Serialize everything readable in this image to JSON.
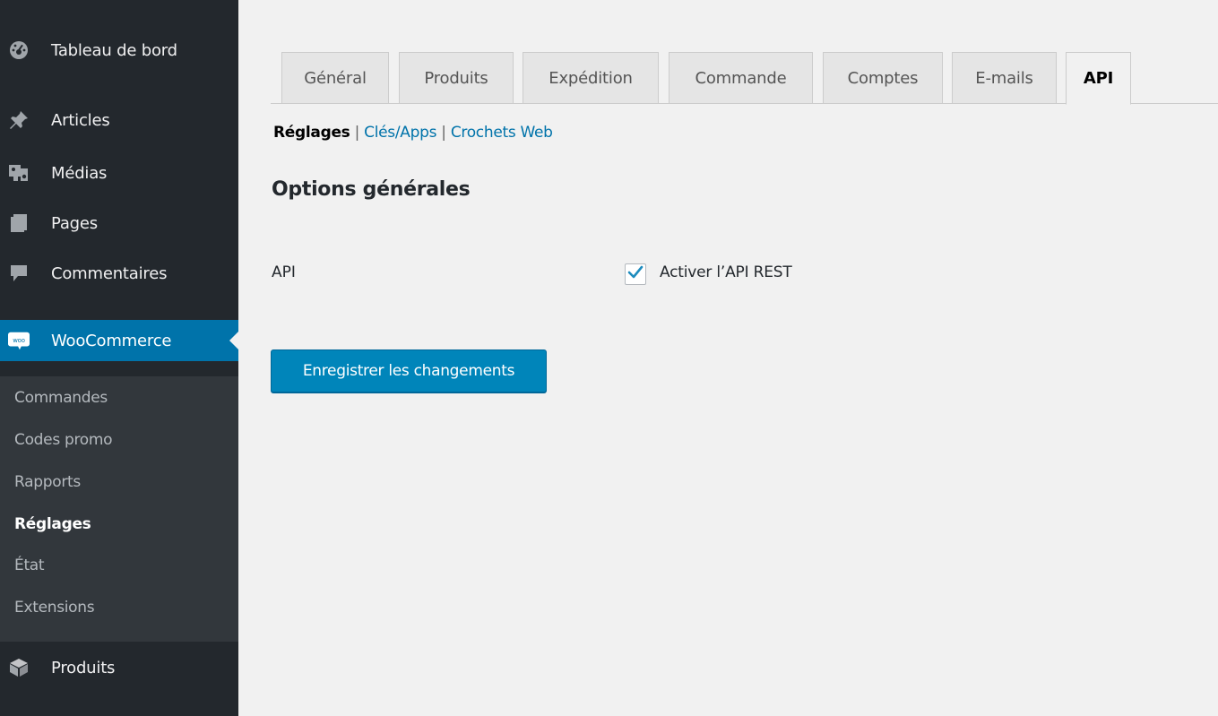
{
  "sidebar": {
    "items": [
      {
        "label": "Tableau de bord",
        "icon": "dashboard-icon"
      },
      {
        "label": "Articles",
        "icon": "pin-icon"
      },
      {
        "label": "Médias",
        "icon": "media-icon"
      },
      {
        "label": "Pages",
        "icon": "pages-icon"
      },
      {
        "label": "Commentaires",
        "icon": "comment-icon"
      },
      {
        "label": "WooCommerce",
        "icon": "woo-icon",
        "badge": "woo"
      },
      {
        "label": "Produits",
        "icon": "box-icon"
      }
    ],
    "submenu": [
      "Commandes",
      "Codes promo",
      "Rapports",
      "Réglages",
      "État",
      "Extensions"
    ]
  },
  "tabs": [
    "Général",
    "Produits",
    "Expédition",
    "Commande",
    "Comptes",
    "E-mails",
    "API"
  ],
  "subnav": {
    "current": "Réglages",
    "sep1": " | ",
    "link1": "Clés/Apps",
    "sep2": " | ",
    "link2": "Crochets Web"
  },
  "section_title": "Options générales",
  "setting": {
    "label": "API",
    "checkbox_label": "Activer l’API REST",
    "checked": true
  },
  "save_button": "Enregistrer les changements",
  "colors": {
    "sidebar": "#23282d",
    "accent": "#0073aa",
    "button": "#0085ba"
  }
}
